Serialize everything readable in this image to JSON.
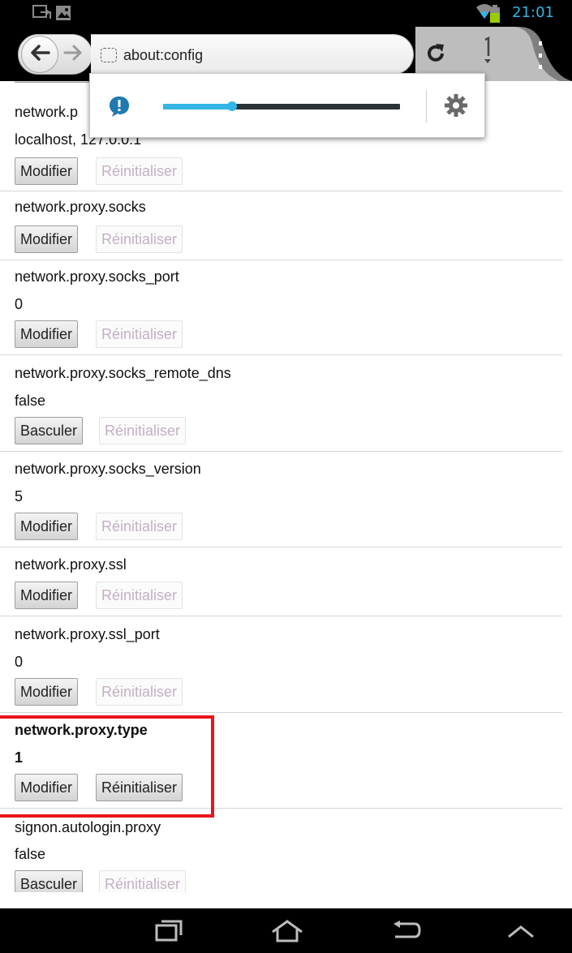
{
  "status_bar": {
    "time": "21:01",
    "accent_color": "#33b5e5",
    "icons": [
      "screen-mirror-icon",
      "image-notification-icon",
      "wifi-icon",
      "battery-icon"
    ]
  },
  "toolbar": {
    "url": "about:config",
    "icons": [
      "back-arrow-icon",
      "forward-arrow-icon",
      "page-icon",
      "reload-icon",
      "tabs-icon",
      "overflow-menu-icon"
    ]
  },
  "popup": {
    "icons": [
      "speech-bubble-icon",
      "gear-icon"
    ],
    "slider_value": 0.29,
    "slider_color": "#33b5e5"
  },
  "entries": [
    {
      "name": "network.p",
      "name_hidden_part": "",
      "value": "localhost, 127.0.0.1",
      "primary": "Modifier",
      "reset": "Réinitialiser",
      "modified": false
    },
    {
      "name": "network.proxy.socks",
      "value": "",
      "primary": "Modifier",
      "reset": "Réinitialiser",
      "modified": false
    },
    {
      "name": "network.proxy.socks_port",
      "value": "0",
      "primary": "Modifier",
      "reset": "Réinitialiser",
      "modified": false
    },
    {
      "name": "network.proxy.socks_remote_dns",
      "value": "false",
      "primary": "Basculer",
      "reset": "Réinitialiser",
      "modified": false
    },
    {
      "name": "network.proxy.socks_version",
      "value": "5",
      "primary": "Modifier",
      "reset": "Réinitialiser",
      "modified": false
    },
    {
      "name": "network.proxy.ssl",
      "value": "",
      "primary": "Modifier",
      "reset": "Réinitialiser",
      "modified": false
    },
    {
      "name": "network.proxy.ssl_port",
      "value": "0",
      "primary": "Modifier",
      "reset": "Réinitialiser",
      "modified": false
    },
    {
      "name": "network.proxy.type",
      "value": "1",
      "primary": "Modifier",
      "reset": "Réinitialiser",
      "modified": true
    },
    {
      "name": "signon.autologin.proxy",
      "value": "false",
      "primary": "Basculer",
      "reset": "Réinitialiser",
      "modified": false
    }
  ],
  "highlight_color": "#e8161c",
  "navbar": {
    "icons": [
      "recent-apps-icon",
      "home-icon",
      "back-icon",
      "collapse-up-icon"
    ]
  }
}
